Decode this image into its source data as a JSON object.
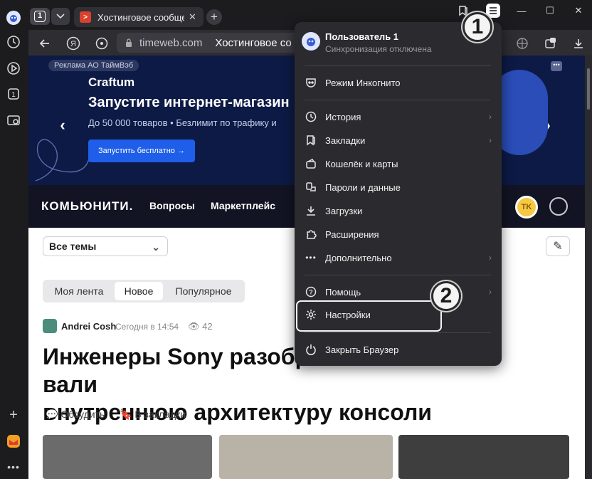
{
  "sidebar": {
    "icons": [
      "profile-icon",
      "history-icon",
      "play-icon",
      "tab-count-icon",
      "screenshot-icon",
      "add-icon",
      "mail-icon",
      "more-icon"
    ]
  },
  "titlebar": {
    "tab_count": "1",
    "tab_title": "Хостинговое сообщест",
    "tab_favicon_letter": ">"
  },
  "address": {
    "domain": "timeweb.com",
    "page_title": "Хостинговое со"
  },
  "banner": {
    "ad_label": "Реклама АО ТаймВэб",
    "brand": "Craftum",
    "headline": "Запустите интернет-магазин",
    "subline": "До 50 000 товаров • Безлимит по трафику и",
    "cta": "Запустить бесплатно →"
  },
  "site": {
    "logo": "КОМЬЮНИТИ.",
    "nav": [
      "Вопросы",
      "Маркетплейс"
    ],
    "avatar": "TK"
  },
  "content": {
    "filter": "Все темы",
    "segments": [
      "Моя лента",
      "Новое",
      "Популярное"
    ],
    "active_segment": "Новое",
    "author": "Andrei Cosh",
    "time": "Сегодня в 14:54",
    "views": "42",
    "title": "Инженеры Sony разобр          вали внутреннюю архитектуру консоли",
    "title_line1_left": "Инженеры Sony разобр",
    "title_line1_right": "вали",
    "title_line2": "внутреннюю архитектуру консоли",
    "discuss": "Обсудить",
    "bookmark": "В закладки"
  },
  "menu": {
    "user_name": "Пользователь 1",
    "user_sub": "Синхронизация отключена",
    "items": [
      {
        "label": "Режим Инкогнито",
        "icon": "incognito-icon",
        "chevron": false
      },
      {
        "label": "История",
        "icon": "history-icon",
        "chevron": true
      },
      {
        "label": "Закладки",
        "icon": "bookmarks-icon",
        "chevron": true
      },
      {
        "label": "Кошелёк и карты",
        "icon": "wallet-icon",
        "chevron": false
      },
      {
        "label": "Пароли и данные",
        "icon": "key-icon",
        "chevron": false
      },
      {
        "label": "Загрузки",
        "icon": "download-icon",
        "chevron": false
      },
      {
        "label": "Расширения",
        "icon": "puzzle-icon",
        "chevron": false
      },
      {
        "label": "Дополнительно",
        "icon": "more-dots-icon",
        "chevron": true
      },
      {
        "label": "Помощь",
        "icon": "help-icon",
        "chevron": true
      },
      {
        "label": "Настройки",
        "icon": "gear-icon",
        "chevron": false
      },
      {
        "label": "Закрыть Браузер",
        "icon": "power-icon",
        "chevron": false
      }
    ]
  },
  "annotations": {
    "step1": "1",
    "step2": "2"
  }
}
